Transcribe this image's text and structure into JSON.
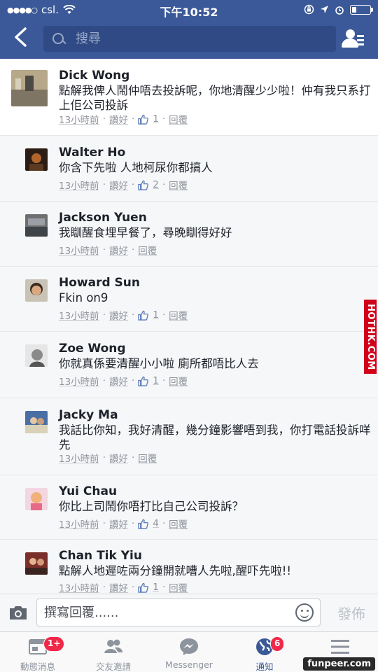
{
  "status_bar": {
    "carrier": "csl.",
    "time": "下午10:52"
  },
  "header": {
    "search_placeholder": "搜尋"
  },
  "comments": [
    {
      "name": "Dick Wong",
      "text": "點解我俾人鬧仲唔去投訴呢，你地清醒少少啦！仲有我只系打上佢公司投訴",
      "time": "13小時前",
      "like_label": "讚好",
      "likes": "1",
      "reply_label": "回覆"
    },
    {
      "name": "Walter Ho",
      "text": "你含下先啦 人地柯尿你都搞人",
      "time": "13小時前",
      "like_label": "讚好",
      "likes": "2",
      "reply_label": "回覆"
    },
    {
      "name": "Jackson Yuen",
      "text": "我瞓醒食埋早餐了，尋晚瞓得好好",
      "time": "13小時前",
      "like_label": "讚好",
      "likes": "",
      "reply_label": "回覆"
    },
    {
      "name": "Howard Sun",
      "text": "Fkin on9",
      "time": "13小時前",
      "like_label": "讚好",
      "likes": "1",
      "reply_label": "回覆"
    },
    {
      "name": "Zoe Wong",
      "text": "你就真係要清醒小小啦 廁所都唔比人去",
      "time": "13小時前",
      "like_label": "讚好",
      "likes": "1",
      "reply_label": "回覆"
    },
    {
      "name": "Jacky Ma",
      "text": "我話比你知，我好清醒，幾分鐘影響唔到我，你打電話投訴咩先",
      "time": "13小時前",
      "like_label": "讚好",
      "likes": "",
      "reply_label": "回覆"
    },
    {
      "name": "Yui Chau",
      "text": "你比上司鬧你唔打比自己公司投訴？",
      "time": "13小時前",
      "like_label": "讚好",
      "likes": "4",
      "reply_label": "回覆"
    },
    {
      "name": "Chan Tik Yiu",
      "text": "點解人地遲咗兩分鐘開就嘈人先啦,醒吓先啦!!",
      "time": "13小時前",
      "like_label": "讚好",
      "likes": "1",
      "reply_label": "回覆"
    }
  ],
  "composer": {
    "placeholder": "撰寫回覆......",
    "post_label": "發佈"
  },
  "tabs": [
    {
      "label": "動態消息",
      "icon": "news-feed-icon",
      "badge": "1+"
    },
    {
      "label": "交友邀請",
      "icon": "friend-requests-icon",
      "badge": ""
    },
    {
      "label": "Messenger",
      "icon": "messenger-icon",
      "badge": ""
    },
    {
      "label": "通知",
      "icon": "globe-notifications-icon",
      "badge": "6"
    },
    {
      "label": "",
      "icon": "menu-icon",
      "badge": ""
    }
  ],
  "watermarks": {
    "side": "HOTHK.COM",
    "bottom": "funpeer.com"
  },
  "colors": {
    "header_blue": "#3b5998",
    "badge_red": "#f02849",
    "meta_gray": "#90949c"
  }
}
